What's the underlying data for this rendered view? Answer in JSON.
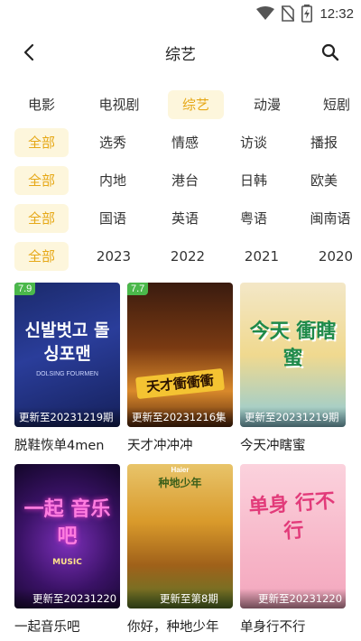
{
  "status": {
    "time": "12:32"
  },
  "nav": {
    "title": "综艺"
  },
  "filters": {
    "types": [
      "电影",
      "电视剧",
      "综艺",
      "动漫",
      "短剧"
    ],
    "genres": [
      "全部",
      "选秀",
      "情感",
      "访谈",
      "播报"
    ],
    "regions": [
      "全部",
      "内地",
      "港台",
      "日韩",
      "欧美"
    ],
    "languages": [
      "全部",
      "国语",
      "英语",
      "粤语",
      "闽南语"
    ],
    "years": [
      "全部",
      "2023",
      "2022",
      "2021",
      "2020"
    ]
  },
  "items": [
    {
      "title": "脱鞋恢单4men",
      "update": "更新至20231219期",
      "rating": "7.9",
      "poster_text": "신발벗고 돌싱포맨",
      "poster_sub": "DOLSING FOURMEN"
    },
    {
      "title": "天才冲冲冲",
      "update": "更新至20231216集",
      "rating": "7.7",
      "poster_text": "天才衝衝衝"
    },
    {
      "title": "今天冲瞎蜜",
      "update": "更新至20231219期",
      "poster_text": "今天 衝瞎蜜"
    },
    {
      "title": "一起音乐吧",
      "update": "更新至20231220",
      "poster_text": "一起 音乐吧",
      "poster_sub": "MUSIC"
    },
    {
      "title": "你好，种地少年",
      "update": "更新至第8期",
      "poster_text": "种地少年",
      "poster_sub": "Haier"
    },
    {
      "title": "单身行不行",
      "update": "更新至20231220",
      "poster_text": "单身 行不行"
    }
  ],
  "colors": {
    "accent": "#e6a817",
    "chip_bg": "#fdf6dc",
    "rating_bg": "#4bb84b"
  }
}
